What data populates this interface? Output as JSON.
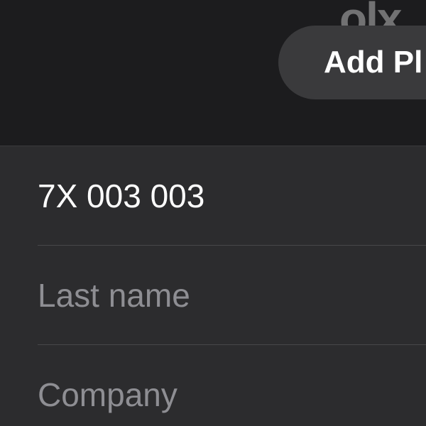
{
  "header": {
    "watermark": "olx",
    "add_photo_label": "Add Pl"
  },
  "form": {
    "first_name_value": "7X 003 003",
    "last_name_placeholder": "Last name",
    "company_placeholder": "Company"
  },
  "colors": {
    "background": "#1c1c1e",
    "card": "#2c2c2e",
    "button": "#3a3a3c",
    "separator": "#48484a",
    "placeholder": "#8e8e93",
    "text": "#ffffff"
  }
}
